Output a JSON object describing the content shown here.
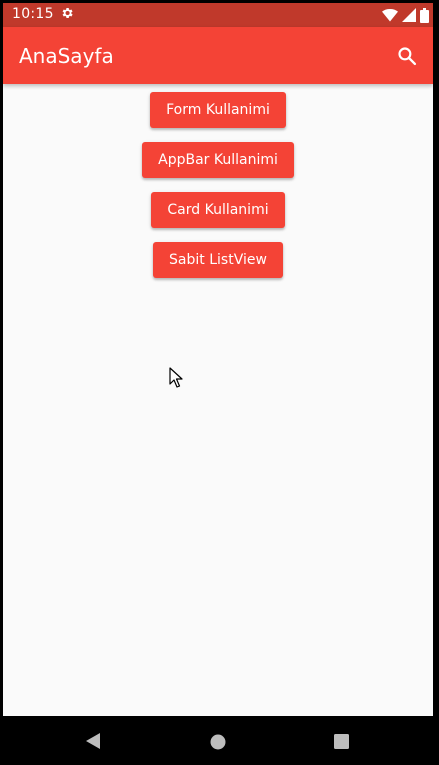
{
  "status_bar": {
    "time": "10:15",
    "icons": [
      "settings-gear-icon",
      "wifi-icon",
      "signal-icon",
      "battery-icon"
    ]
  },
  "app_bar": {
    "title": "AnaSayfa",
    "action_icon": "search-icon"
  },
  "buttons": [
    {
      "label": "Form Kullanimi"
    },
    {
      "label": "AppBar Kullanimi"
    },
    {
      "label": "Card Kullanimi"
    },
    {
      "label": "Sabit ListView"
    }
  ],
  "nav_bar": {
    "icons": [
      "back-icon",
      "home-icon",
      "recents-icon"
    ]
  },
  "colors": {
    "status_bar": "#c0392b",
    "primary": "#f44336",
    "background": "#fafafa",
    "on_primary": "#ffffff"
  }
}
